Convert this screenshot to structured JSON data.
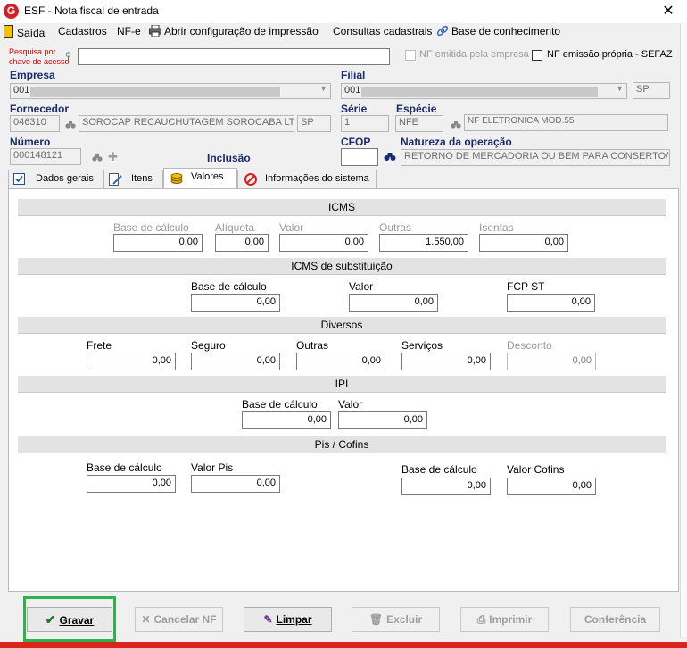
{
  "window": {
    "title": "ESF - Nota fiscal de entrada",
    "close_glyph": "✕",
    "logo_letter": "G"
  },
  "menu": [
    {
      "label": "Saída",
      "icon": "exit-door-icon"
    },
    {
      "label": "Cadastros"
    },
    {
      "label": "NF-e"
    },
    {
      "label": "Abrir configuração de impressão",
      "icon": "printer-icon"
    },
    {
      "label": "Consultas cadastrais"
    },
    {
      "label": "Base de conhecimento",
      "icon": "link-icon"
    }
  ],
  "search": {
    "label_line1": "Pesquisa por",
    "label_line2": "chave de acesso",
    "value": ""
  },
  "checkboxes": {
    "nf_emitida": "NF emitida pela empresa",
    "nf_propria": "NF emissão própria - SEFAZ"
  },
  "empresa": {
    "label": "Empresa",
    "code": "001"
  },
  "filial": {
    "label": "Filial",
    "code": "001",
    "uf": "SP"
  },
  "fornecedor": {
    "label": "Fornecedor",
    "code": "046310",
    "name": "SOROCAP RECAUCHUTAGEM SOROCABA LTD",
    "uf": "SP"
  },
  "serie": {
    "label": "Série",
    "value": "1"
  },
  "especie": {
    "label": "Espécie",
    "value": "NFE",
    "desc": "NF ELETRONICA MOD.55"
  },
  "numero": {
    "label": "Número",
    "value": "000148121"
  },
  "inclusao": {
    "label": "Inclusão"
  },
  "cfop": {
    "label": "CFOP",
    "value": ""
  },
  "natureza": {
    "label": "Natureza da operação",
    "value": "RETORNO DE MERCADORIA OU BEM PARA CONSERTO/R"
  },
  "tabs": [
    {
      "label": "Dados gerais",
      "icon": "checkbox-icon"
    },
    {
      "label": "Itens",
      "icon": "document-edit-icon"
    },
    {
      "label": "Valores",
      "icon": "coins-icon",
      "active": true
    },
    {
      "label": "Informações do sistema",
      "icon": "no-entry-icon"
    }
  ],
  "icms": {
    "title": "ICMS",
    "base_label": "Base de cálculo",
    "base": "0,00",
    "aliq_label": "Alíquota",
    "aliq": "0,00",
    "valor_label": "Valor",
    "valor": "0,00",
    "outras_label": "Outras",
    "outras": "1.550,00",
    "isentas_label": "Isentas",
    "isentas": "0,00"
  },
  "icms_st": {
    "title": "ICMS de substituição",
    "base_label": "Base de cálculo",
    "base": "0,00",
    "valor_label": "Valor",
    "valor": "0,00",
    "fcp_label": "FCP ST",
    "fcp": "0,00"
  },
  "diversos": {
    "title": "Diversos",
    "frete_label": "Frete",
    "frete": "0,00",
    "seguro_label": "Seguro",
    "seguro": "0,00",
    "outras_label": "Outras",
    "outras": "0,00",
    "servicos_label": "Serviços",
    "servicos": "0,00",
    "desconto_label": "Desconto",
    "desconto": "0,00"
  },
  "ipi": {
    "title": "IPI",
    "base_label": "Base de cálculo",
    "base": "0,00",
    "valor_label": "Valor",
    "valor": "0,00"
  },
  "pis_cofins": {
    "title": "Pis / Cofins",
    "pis_base_label": "Base de cálculo",
    "pis_base": "0,00",
    "pis_valor_label": "Valor Pis",
    "pis_valor": "0,00",
    "cofins_base_label": "Base de cálculo",
    "cofins_base": "0,00",
    "cofins_valor_label": "Valor Cofins",
    "cofins_valor": "0,00"
  },
  "buttons": {
    "gravar": "Gravar",
    "cancelar": "Cancelar NF",
    "limpar": "Limpar",
    "excluir": "Excluir",
    "imprimir": "Imprimir",
    "conferencia": "Conferência"
  }
}
